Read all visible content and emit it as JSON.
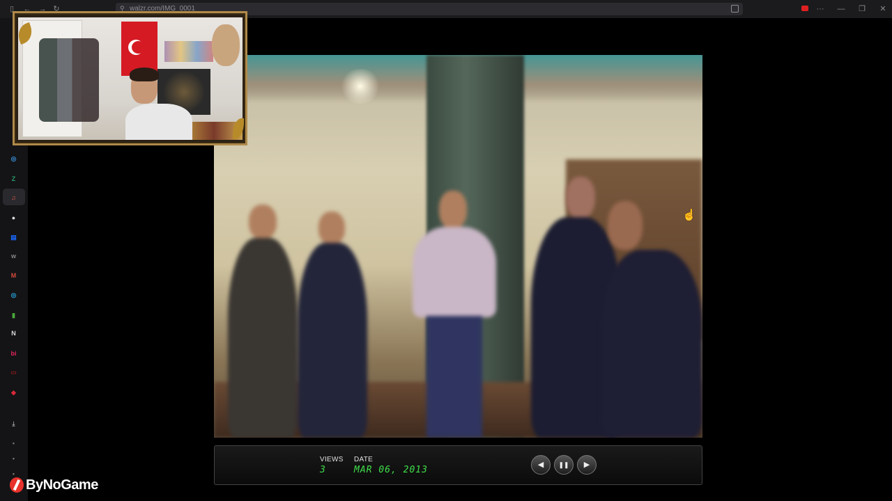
{
  "browser": {
    "url": "walzr.com/IMG_0001"
  },
  "sidebar": {
    "items": [
      {
        "icon": "chatgpt-icon",
        "glyph": "◎",
        "color": "#3a8fd8"
      },
      {
        "icon": "z-app-icon",
        "glyph": "Z",
        "color": "#2a9a6a"
      },
      {
        "icon": "music-player-icon",
        "glyph": "♫",
        "color": "#e05a4a"
      },
      {
        "icon": "circle-app-icon",
        "glyph": "●",
        "color": "#dddddd"
      },
      {
        "icon": "terminal-icon",
        "glyph": "▤",
        "color": "#1a6aff"
      },
      {
        "icon": "w-app-icon",
        "glyph": "w",
        "color": "#888888"
      },
      {
        "icon": "gmail-icon",
        "glyph": "M",
        "color": "#d34a3a"
      },
      {
        "icon": "colorful-app-icon",
        "glyph": "◎",
        "color": "#28a0d8"
      },
      {
        "icon": "green-app-icon",
        "glyph": "▮",
        "color": "#4aaa3a"
      },
      {
        "icon": "notion-icon",
        "glyph": "N",
        "color": "#dddddd"
      },
      {
        "icon": "bi-app-icon",
        "glyph": "bi",
        "color": "#e0265a"
      },
      {
        "icon": "red-app-icon",
        "glyph": "▭",
        "color": "#8a1a1a"
      },
      {
        "icon": "game-app-icon",
        "glyph": "◆",
        "color": "#d82a3a"
      },
      {
        "icon": "download-icon",
        "glyph": "⤓",
        "color": "#999999"
      },
      {
        "icon": "more-dot-icon",
        "glyph": "•",
        "color": "#777777"
      },
      {
        "icon": "more-dot-icon",
        "glyph": "•",
        "color": "#777777"
      },
      {
        "icon": "more-dot-icon",
        "glyph": "•",
        "color": "#777777"
      }
    ]
  },
  "viewer": {
    "views_label": "VIEWS",
    "views_value": "3",
    "date_label": "DATE",
    "date_value": "MAR 06, 2013",
    "prev_glyph": "◀",
    "pause_glyph": "❚❚",
    "next_glyph": "▶"
  },
  "watermark": {
    "text": "ByNoGame"
  },
  "colors": {
    "digital_green": "#3fe04a",
    "sidebar_bg": "#141416",
    "webcam_frame": "#b08a4a"
  }
}
